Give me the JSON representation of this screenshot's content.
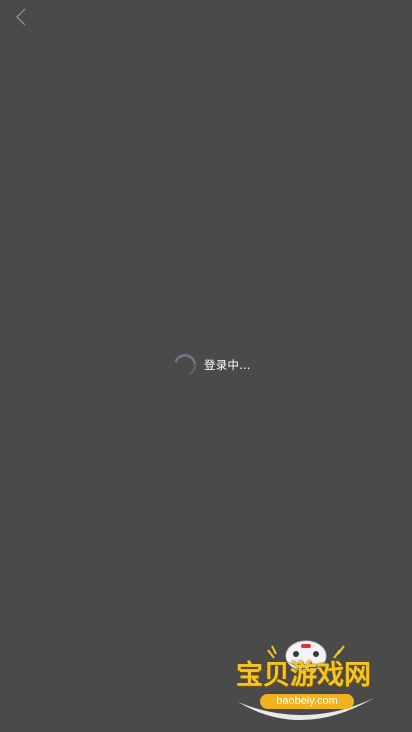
{
  "header": {
    "back_icon": "chevron-left-icon"
  },
  "loading": {
    "text": "登录中...",
    "spinner_icon": "spinner-icon"
  },
  "watermark": {
    "title": "宝贝游戏网",
    "url": "baobeiy.com",
    "title_color": "#f2c526",
    "url_bg_color": "#f2b21e"
  },
  "colors": {
    "background": "#4a4a4a",
    "text": "#ffffff",
    "spinner": "#7a7f90"
  }
}
